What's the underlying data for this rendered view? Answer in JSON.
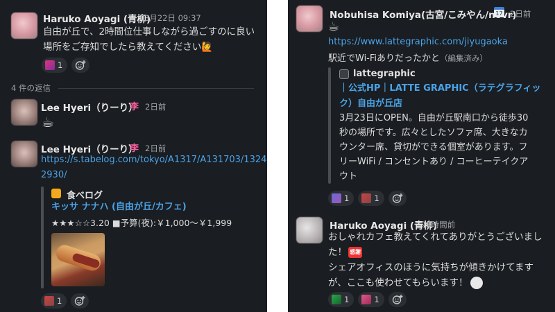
{
  "left": {
    "msg1": {
      "name": "Haruko Aoyagi (青柳)",
      "time": "3月22日 09:37",
      "line1": "自由が丘で、2時間位仕事しながら過ごすのに良い",
      "line2": "場所をご存知でしたら教えてください🙋",
      "reaction_count": "1"
    },
    "thread_label": "4 件の返信",
    "msg2": {
      "name": "Lee Hyeri（りーり）",
      "badge": "李",
      "time": "2日前",
      "emoji": "☕"
    },
    "msg3": {
      "name": "Lee Hyeri（りーり）",
      "badge": "李",
      "time": "2日前",
      "url_line1": "https://s.tabelog.com/tokyo/A1317/A131703/1324",
      "url_line2": "2930/",
      "card": {
        "site": "食べログ",
        "title": "キッサ ナナハ (自由が丘/カフェ)",
        "rating": "★★★☆☆3.20 ■予算(夜):￥1,000～￥1,999"
      },
      "reaction_count": "1"
    }
  },
  "right": {
    "msg1": {
      "name": "Nobuhisa Komiya(古宮/こみやん/novr)",
      "calendar_icon": "17",
      "time": "2日前",
      "emoji": "☕",
      "url": "https://www.lattegraphic.com/jiyugaoka",
      "text": "駅近でWi-Fiありだったかと",
      "edited": "（編集済み）",
      "card": {
        "site": "lattegraphic",
        "title_line1": "｜公式HP｜LATTE GRAPHIC（ラテグラフィッ",
        "title_line2": "ク）自由が丘店",
        "desc_lines": [
          "3月23日にOPEN。自由が丘駅南口から徒歩30",
          "秒の場所です。広々としたソファ席、大きなカ",
          "ウンター席、貸切ができる個室があります。フ",
          "リーWiFi / コンセントあり / コーヒーテイクア",
          "ウト"
        ]
      },
      "reaction1_count": "1",
      "reaction2_count": "1"
    },
    "msg2": {
      "name": "Haruko Aoyagi (青柳)",
      "time": "23時間前",
      "line1": "おしゃれカフェ教えてくれてありがとうございまし",
      "line2": "た！",
      "line2_emoji": "感謝",
      "line3": "シェアオフィスのほうに気持ちが傾きかけてます",
      "line4": "が、ここも使わせてもらいます！",
      "reaction1_count": "1",
      "reaction2_count": "1"
    }
  },
  "colors": {
    "background": "#1a1d21",
    "link": "#4aa3e8",
    "badge_pink": "#ff5fa2"
  }
}
